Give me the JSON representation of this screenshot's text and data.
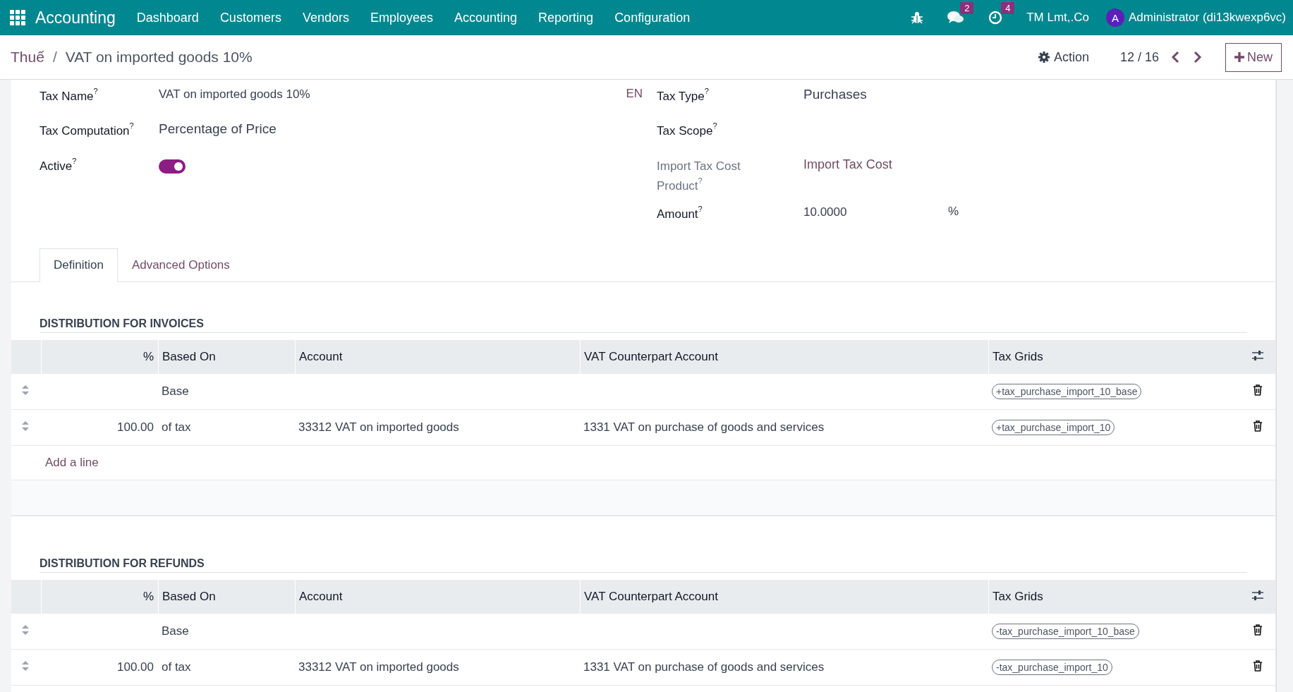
{
  "navbar": {
    "app_name": "Accounting",
    "menu": [
      "Dashboard",
      "Customers",
      "Vendors",
      "Employees",
      "Accounting",
      "Reporting",
      "Configuration"
    ],
    "messages_count": "2",
    "activities_count": "4",
    "company": "TM Lmt,.Co",
    "user_initial": "A",
    "user_name": "Administrator (di13kwexp6vc)"
  },
  "breadcrumb": {
    "parent": "Thuế",
    "separator": "/",
    "current": "VAT on imported goods 10%"
  },
  "control": {
    "action": "Action",
    "pager": "12 / 16",
    "new": "New"
  },
  "form": {
    "left_fields": [
      {
        "kind": "text",
        "label": "Tax Name",
        "help": "?",
        "value": "VAT on imported goods 10%",
        "lang": "EN"
      },
      {
        "kind": "select",
        "label": "Tax Computation",
        "help": "?",
        "value": "Percentage of Price"
      },
      {
        "kind": "toggle",
        "label": "Active",
        "help": "?",
        "on": true
      }
    ],
    "right_fields": [
      {
        "kind": "select",
        "label": "Tax Type",
        "help": "?",
        "value": "Purchases"
      },
      {
        "kind": "select",
        "label": "Tax Scope",
        "help": "?"
      },
      {
        "kind": "link",
        "label": "Import Tax Cost Product",
        "help": "?",
        "value": "Import Tax Cost",
        "readonly": true
      },
      {
        "kind": "text",
        "label": "Amount",
        "help": "?",
        "value": "10.0000",
        "suffix": "%"
      }
    ]
  },
  "tabs": [
    {
      "label": "Definition",
      "selected": true
    },
    {
      "label": "Advanced Options",
      "selected": false
    }
  ],
  "sections": [
    {
      "title": "DISTRIBUTION FOR INVOICES",
      "columns": [
        "%",
        "Based On",
        "Account",
        "VAT Counterpart Account",
        "Tax Grids"
      ],
      "rows": [
        {
          "based_on": "Base",
          "tax_grid": "+tax_purchase_import_10_base"
        },
        {
          "percent": "100.00",
          "based_on": "of tax",
          "account": "33312 VAT on imported goods",
          "counterpart": "1331 VAT on purchase of goods and services",
          "tax_grid": "+tax_purchase_import_10"
        }
      ],
      "add_line": "Add a line"
    },
    {
      "title": "DISTRIBUTION FOR REFUNDS",
      "columns": [
        "%",
        "Based On",
        "Account",
        "VAT Counterpart Account",
        "Tax Grids"
      ],
      "rows": [
        {
          "based_on": "Base",
          "tax_grid": "-tax_purchase_import_10_base"
        },
        {
          "percent": "100.00",
          "based_on": "of tax",
          "account": "33312 VAT on imported goods",
          "counterpart": "1331 VAT on purchase of goods and services",
          "tax_grid": "-tax_purchase_import_10"
        }
      ]
    }
  ]
}
